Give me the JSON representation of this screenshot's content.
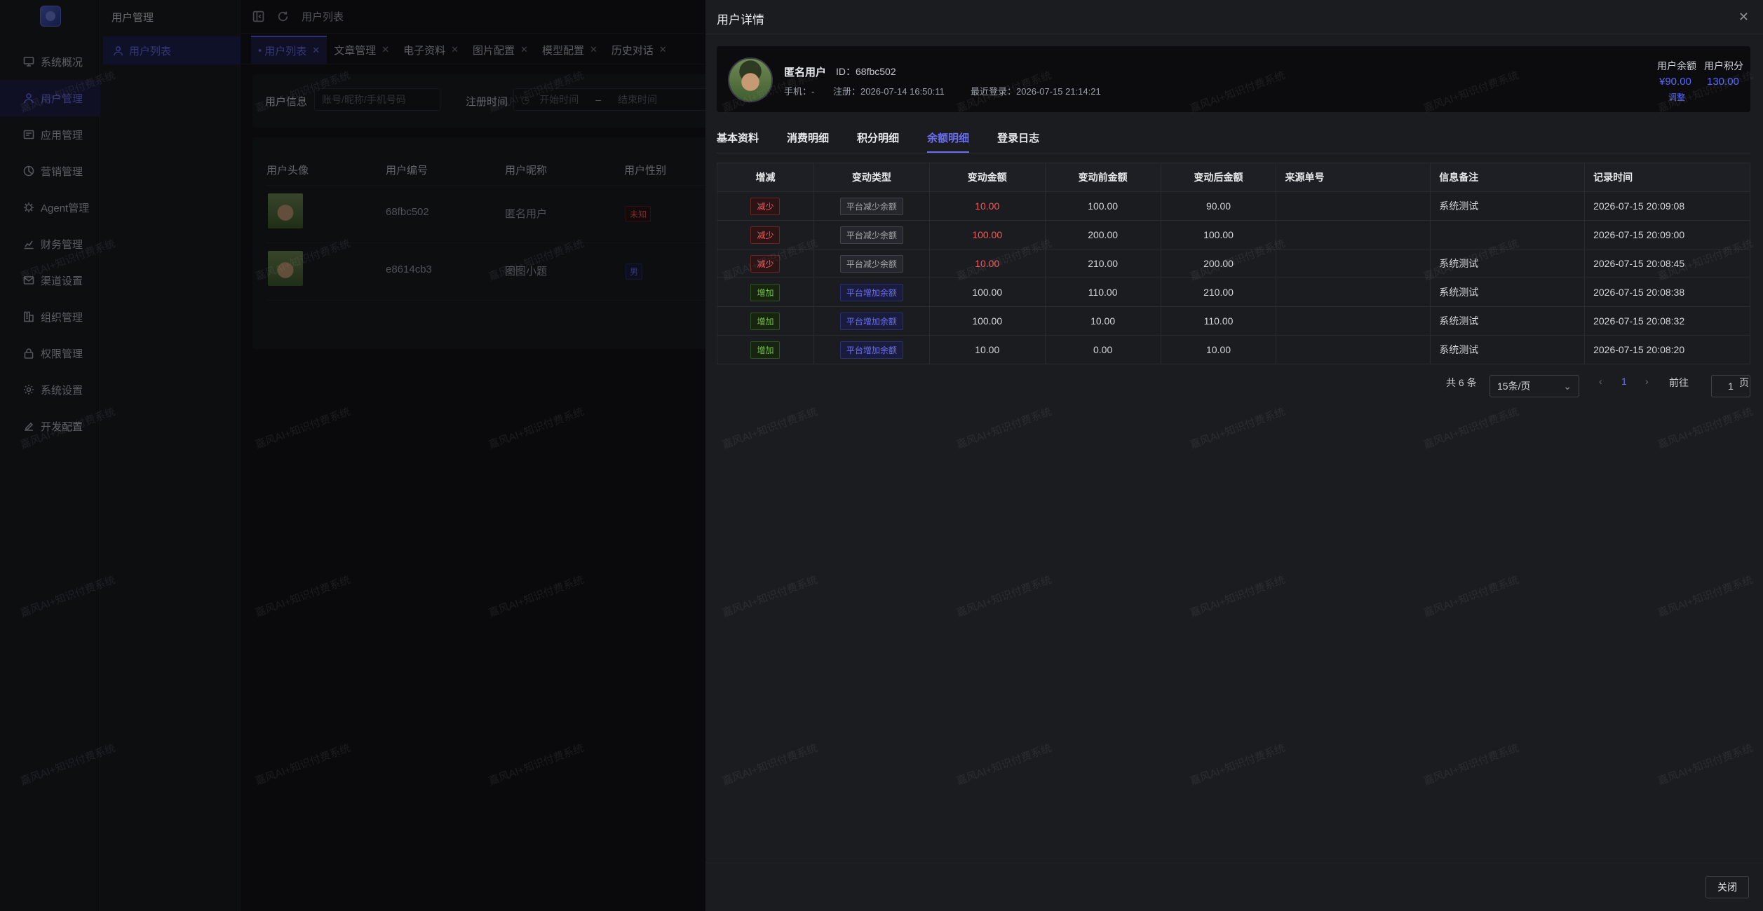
{
  "sidebar": {
    "items": [
      {
        "label": "系统概况",
        "icon": "monitor-icon"
      },
      {
        "label": "用户管理",
        "icon": "user-icon",
        "active": true
      },
      {
        "label": "应用管理",
        "icon": "app-icon"
      },
      {
        "label": "营销管理",
        "icon": "marketing-icon"
      },
      {
        "label": "Agent管理",
        "icon": "agent-icon"
      },
      {
        "label": "财务管理",
        "icon": "chart-icon"
      },
      {
        "label": "渠道设置",
        "icon": "mail-icon"
      },
      {
        "label": "组织管理",
        "icon": "building-icon"
      },
      {
        "label": "权限管理",
        "icon": "lock-icon"
      },
      {
        "label": "系统设置",
        "icon": "gear-icon"
      },
      {
        "label": "开发配置",
        "icon": "edit-icon"
      }
    ]
  },
  "subsidebar": {
    "title": "用户管理",
    "item": "用户列表"
  },
  "header": {
    "breadcrumb": "用户列表"
  },
  "tabs": [
    {
      "label": "用户列表",
      "active": true
    },
    {
      "label": "文章管理"
    },
    {
      "label": "电子资料"
    },
    {
      "label": "图片配置"
    },
    {
      "label": "模型配置"
    },
    {
      "label": "历史对话"
    }
  ],
  "filter": {
    "user_info_label": "用户信息",
    "user_info_placeholder": "账号/昵称/手机号码",
    "reg_time_label": "注册时间",
    "start_placeholder": "开始时间",
    "end_placeholder": "结束时间",
    "range_sep": "–"
  },
  "user_table": {
    "headers": [
      "用户头像",
      "用户编号",
      "用户昵称",
      "用户性别"
    ],
    "rows": [
      {
        "id": "68fbc502",
        "nickname": "匿名用户",
        "gender": "未知"
      },
      {
        "id": "e8614cb3",
        "nickname": "图图小题",
        "gender": "男"
      }
    ]
  },
  "drawer": {
    "title": "用户详情",
    "close_label": "关闭",
    "user": {
      "name": "匿名用户",
      "id_label": "ID：",
      "id": "68fbc502",
      "phone": "手机：-",
      "register": "注册：2026-07-14 16:50:11",
      "last_login": "最近登录：2026-07-15 21:14:21",
      "balance_label": "用户余额",
      "balance_value": "¥90.00",
      "adjust_label": "调整",
      "points_label": "用户积分",
      "points_value": "130.00"
    },
    "tabs": [
      "基本资料",
      "消费明细",
      "积分明细",
      "余额明细",
      "登录日志"
    ],
    "active_tab": "余额明细",
    "table": {
      "headers": [
        "增减",
        "变动类型",
        "变动金额",
        "变动前金额",
        "变动后金额",
        "来源单号",
        "信息备注",
        "记录时间"
      ],
      "rows": [
        {
          "dir": "减少",
          "type": "平台减少余额",
          "amount": "10.00",
          "before": "100.00",
          "after": "90.00",
          "source": "",
          "note": "系统测试",
          "time": "2026-07-15 20:09:08"
        },
        {
          "dir": "减少",
          "type": "平台减少余额",
          "amount": "100.00",
          "before": "200.00",
          "after": "100.00",
          "source": "",
          "note": "",
          "time": "2026-07-15 20:09:00"
        },
        {
          "dir": "减少",
          "type": "平台减少余额",
          "amount": "10.00",
          "before": "210.00",
          "after": "200.00",
          "source": "",
          "note": "系统测试",
          "time": "2026-07-15 20:08:45"
        },
        {
          "dir": "增加",
          "type": "平台增加余额",
          "amount": "100.00",
          "before": "110.00",
          "after": "210.00",
          "source": "",
          "note": "系统测试",
          "time": "2026-07-15 20:08:38"
        },
        {
          "dir": "增加",
          "type": "平台增加余额",
          "amount": "100.00",
          "before": "10.00",
          "after": "110.00",
          "source": "",
          "note": "系统测试",
          "time": "2026-07-15 20:08:32"
        },
        {
          "dir": "增加",
          "type": "平台增加余额",
          "amount": "10.00",
          "before": "0.00",
          "after": "10.00",
          "source": "",
          "note": "系统测试",
          "time": "2026-07-15 20:08:20"
        }
      ]
    },
    "pagination": {
      "total": "共 6 条",
      "page_size": "15条/页",
      "current": "1",
      "goto_label": "前往",
      "goto_value": "1",
      "page_suffix": "页",
      "prev": "‹",
      "next": "›"
    }
  },
  "watermark": "嘉风AI+知识付费系统",
  "colors": {
    "accent": "#6a6ff5",
    "danger": "#f25a5a",
    "success": "#78c44a"
  }
}
